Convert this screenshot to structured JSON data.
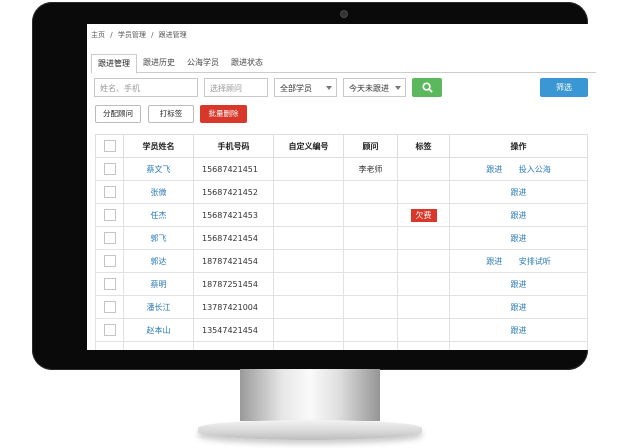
{
  "breadcrumb": [
    "主页",
    "/",
    "学员管理",
    "/",
    "跟进管理"
  ],
  "tabs": [
    "跟进管理",
    "跟进历史",
    "公海学员",
    "跟进状态"
  ],
  "filters": {
    "name_phone_placeholder": "姓名、手机",
    "advisor_placeholder": "选择顾问",
    "student_select": "全部学员",
    "followup_select": "今天未跟进"
  },
  "buttons": {
    "filter": "筛选",
    "assign_advisor": "分配顾问",
    "tag": "打标签",
    "batch_delete": "批量删除"
  },
  "table": {
    "headers": [
      "学员姓名",
      "手机号码",
      "自定义编号",
      "顾问",
      "标签",
      "操作"
    ],
    "rows": [
      {
        "name": "蔡文飞",
        "phone": "15687421451",
        "custom_id": "",
        "advisor": "李老师",
        "tag": "",
        "actions": [
          "跟进",
          "投入公海"
        ]
      },
      {
        "name": "张微",
        "phone": "15687421452",
        "custom_id": "",
        "advisor": "",
        "tag": "",
        "actions": [
          "跟进"
        ]
      },
      {
        "name": "任杰",
        "phone": "15687421453",
        "custom_id": "",
        "advisor": "",
        "tag": "欠费",
        "actions": [
          "跟进"
        ]
      },
      {
        "name": "郭飞",
        "phone": "15687421454",
        "custom_id": "",
        "advisor": "",
        "tag": "",
        "actions": [
          "跟进"
        ]
      },
      {
        "name": "郭达",
        "phone": "18787421454",
        "custom_id": "",
        "advisor": "",
        "tag": "",
        "actions": [
          "跟进",
          "安排试听"
        ]
      },
      {
        "name": "蔡明",
        "phone": "18787251454",
        "custom_id": "",
        "advisor": "",
        "tag": "",
        "actions": [
          "跟进"
        ]
      },
      {
        "name": "潘长江",
        "phone": "13787421004",
        "custom_id": "",
        "advisor": "",
        "tag": "",
        "actions": [
          "跟进"
        ]
      },
      {
        "name": "赵本山",
        "phone": "13547421454",
        "custom_id": "",
        "advisor": "",
        "tag": "",
        "actions": [
          "跟进"
        ]
      }
    ]
  },
  "colors": {
    "primary_blue": "#3a97d4",
    "search_green": "#5cb85c",
    "danger_red": "#d9372a",
    "link_blue": "#2a7ab8"
  }
}
